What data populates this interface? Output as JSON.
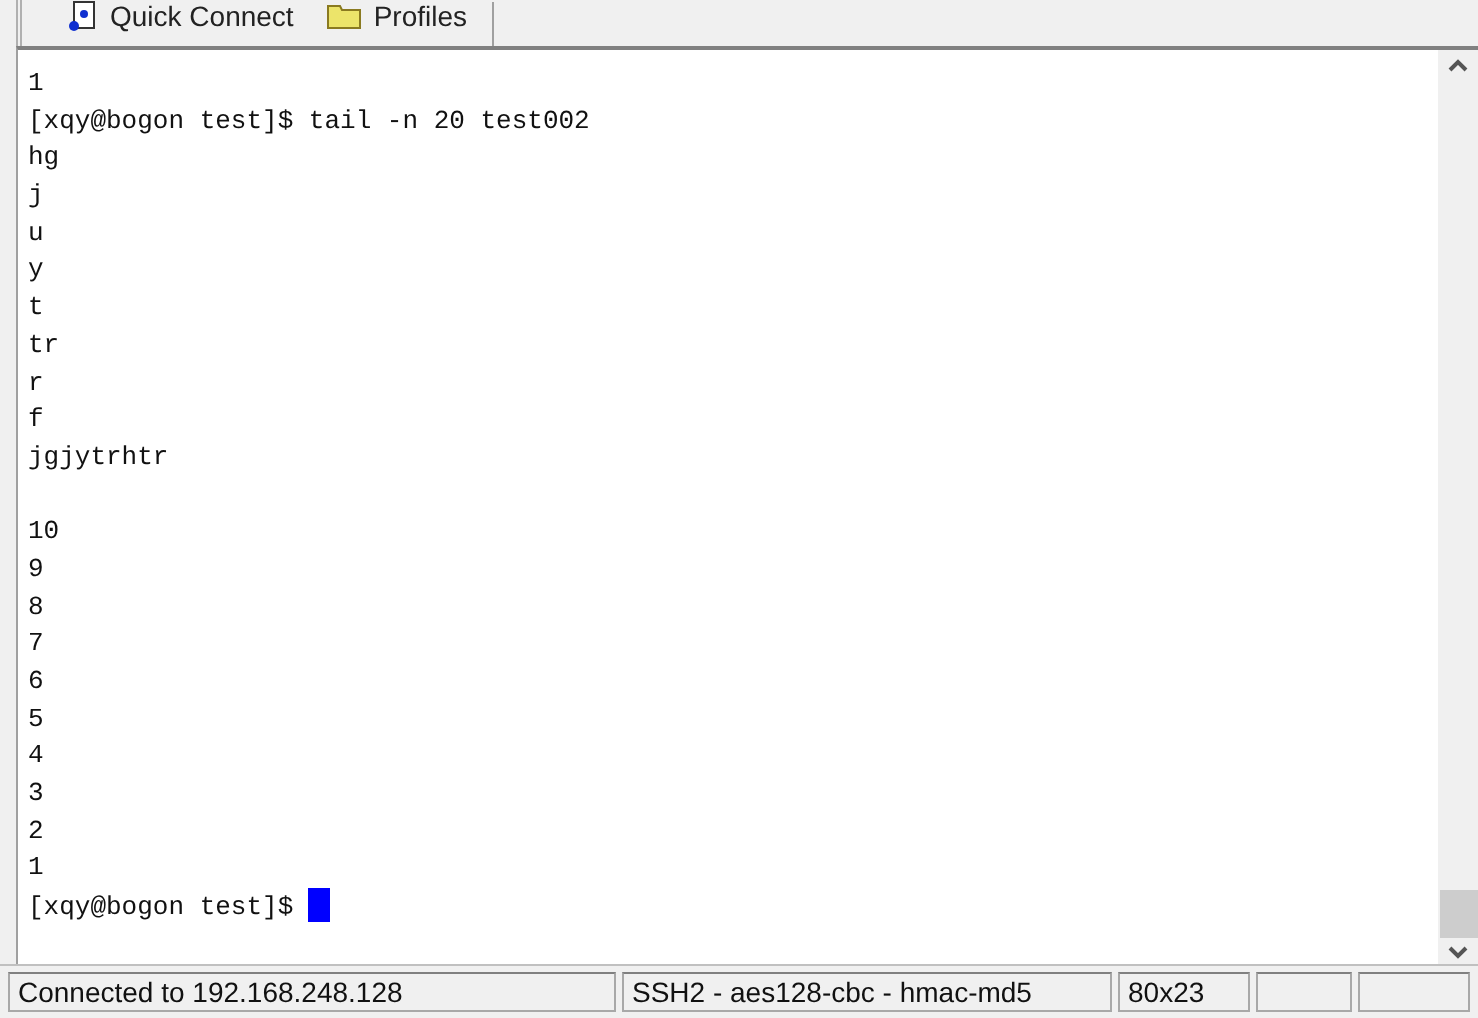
{
  "toolbar": {
    "buttons": [
      {
        "kind": "quick-connect",
        "label": "Quick Connect"
      },
      {
        "kind": "profiles",
        "label": "Profiles"
      }
    ]
  },
  "terminal": {
    "lines": [
      {
        "kind": "output",
        "text": "1"
      },
      {
        "kind": "prompt",
        "text": "[xqy@bogon test]$ tail -n 20 test002",
        "cursor": false
      },
      {
        "kind": "output",
        "text": "hg"
      },
      {
        "kind": "output",
        "text": "j"
      },
      {
        "kind": "output",
        "text": "u"
      },
      {
        "kind": "output",
        "text": "y"
      },
      {
        "kind": "output",
        "text": "t"
      },
      {
        "kind": "output",
        "text": "tr"
      },
      {
        "kind": "output",
        "text": "r"
      },
      {
        "kind": "output",
        "text": "f"
      },
      {
        "kind": "output",
        "text": "jgjytrhtr"
      },
      {
        "kind": "blank"
      },
      {
        "kind": "output",
        "text": "10"
      },
      {
        "kind": "output",
        "text": "9"
      },
      {
        "kind": "output",
        "text": "8"
      },
      {
        "kind": "output",
        "text": "7"
      },
      {
        "kind": "output",
        "text": "6"
      },
      {
        "kind": "output",
        "text": "5"
      },
      {
        "kind": "output",
        "text": "4"
      },
      {
        "kind": "output",
        "text": "3"
      },
      {
        "kind": "output",
        "text": "2"
      },
      {
        "kind": "output",
        "text": "1"
      },
      {
        "kind": "prompt",
        "text": "[xqy@bogon test]$ ",
        "cursor": true
      }
    ]
  },
  "status_bar": {
    "connection": "Connected to 192.168.248.128",
    "protocol": "SSH2 - aes128-cbc - hmac-md5",
    "size": "80x23"
  }
}
